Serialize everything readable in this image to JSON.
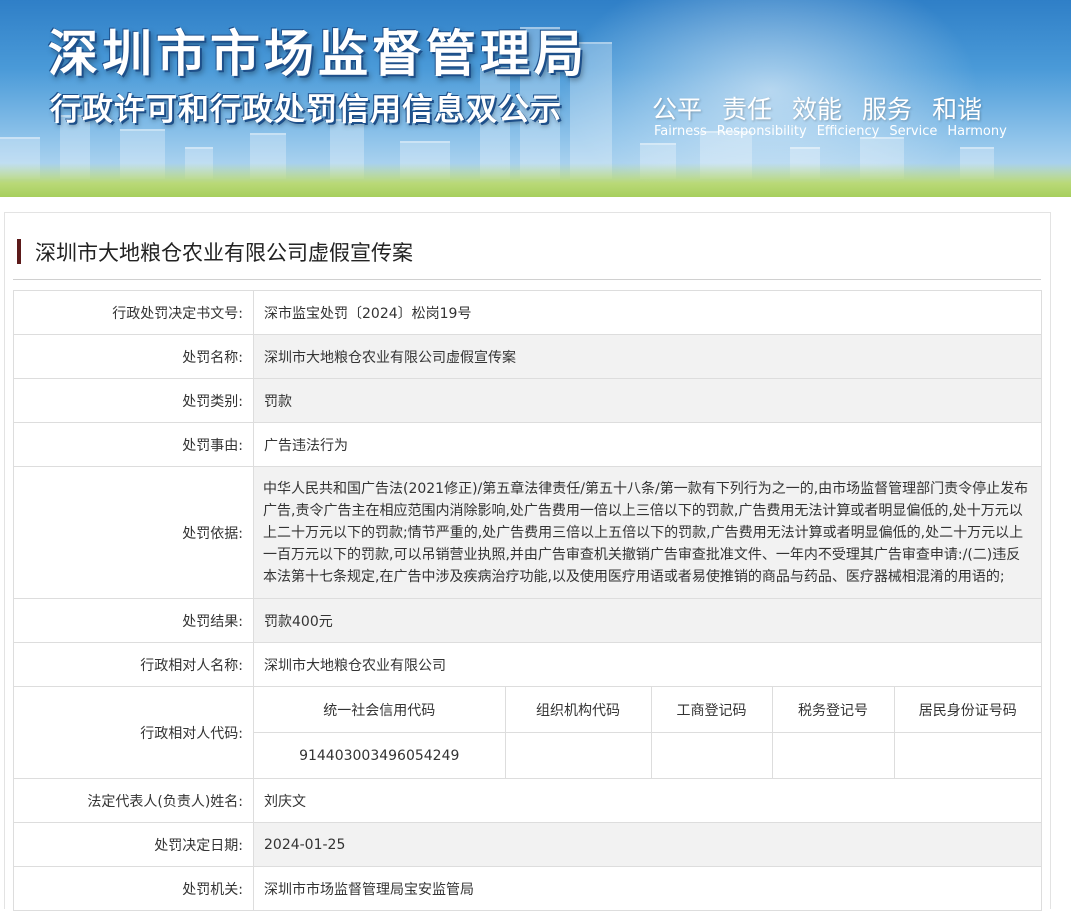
{
  "banner": {
    "title": "深圳市市场监督管理局",
    "subtitle": "行政许可和行政处罚信用信息双公示",
    "values_cn": [
      "公平",
      "责任",
      "效能",
      "服务",
      "和谐"
    ],
    "values_en": [
      "Fairness",
      "Responsibility",
      "Efficiency",
      "Service",
      "Harmony"
    ]
  },
  "case": {
    "title": "深圳市大地粮仓农业有限公司虚假宣传案"
  },
  "fields": {
    "decision_no": {
      "label": "行政处罚决定书文号:",
      "value": "深市监宝处罚〔2024〕松岗19号"
    },
    "penalty_name": {
      "label": "处罚名称:",
      "value": "深圳市大地粮仓农业有限公司虚假宣传案"
    },
    "penalty_type": {
      "label": "处罚类别:",
      "value": "罚款"
    },
    "penalty_reason": {
      "label": "处罚事由:",
      "value": "广告违法行为"
    },
    "penalty_basis": {
      "label": "处罚依据:",
      "value": "中华人民共和国广告法(2021修正)/第五章法律责任/第五十八条/第一款有下列行为之一的,由市场监督管理部门责令停止发布广告,责令广告主在相应范围内消除影响,处广告费用一倍以上三倍以下的罚款,广告费用无法计算或者明显偏低的,处十万元以上二十万元以下的罚款;情节严重的,处广告费用三倍以上五倍以下的罚款,广告费用无法计算或者明显偏低的,处二十万元以上一百万元以下的罚款,可以吊销营业执照,并由广告审查机关撤销广告审查批准文件、一年内不受理其广告审查申请:/(二)违反本法第十七条规定,在广告中涉及疾病治疗功能,以及使用医疗用语或者易使推销的商品与药品、医疗器械相混淆的用语的;"
    },
    "penalty_result": {
      "label": "处罚结果:",
      "value": "罚款400元"
    },
    "party_name": {
      "label": "行政相对人名称:",
      "value": "深圳市大地粮仓农业有限公司"
    },
    "party_code": {
      "label": "行政相对人代码:",
      "headers": [
        "统一社会信用代码",
        "组织机构代码",
        "工商登记码",
        "税务登记号",
        "居民身份证号码"
      ],
      "values": [
        "914403003496054249",
        "",
        "",
        "",
        ""
      ]
    },
    "legal_rep": {
      "label": "法定代表人(负责人)姓名:",
      "value": "刘庆文"
    },
    "decision_date": {
      "label": "处罚决定日期:",
      "value": "2024-01-25"
    },
    "authority": {
      "label": "处罚机关:",
      "value": "深圳市市场监督管理局宝安监管局"
    }
  }
}
